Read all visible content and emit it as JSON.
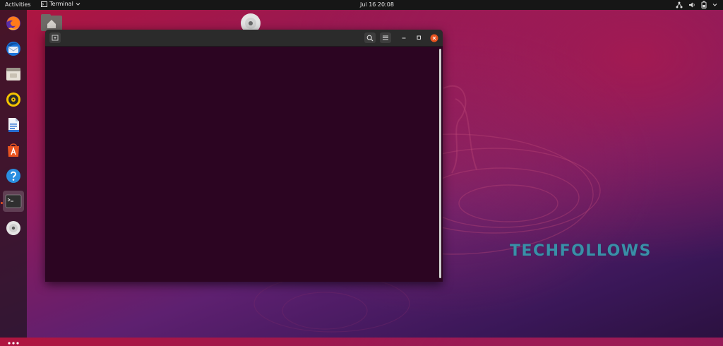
{
  "topbar": {
    "activities": "Activities",
    "app_menu": "Terminal",
    "clock": "Jul 16  20:08"
  },
  "dock": {
    "items": [
      "firefox",
      "thunderbird",
      "files",
      "rhythmbox",
      "libreoffice-writer",
      "software",
      "help",
      "terminal",
      "disc"
    ]
  },
  "watermark": "TECHFOLLOWS",
  "colors": {
    "terminal_bg": "#2c0522",
    "header_bg": "#2b2b2b",
    "close_button": "#e95420",
    "topbar_bg": "#161616",
    "watermark": "#3a8fa8"
  }
}
